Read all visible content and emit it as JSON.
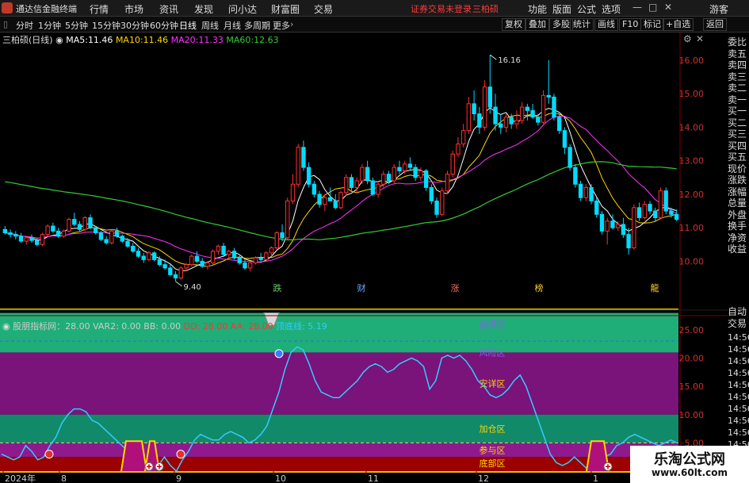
{
  "app": {
    "title": "通达信金融终端"
  },
  "menu": [
    "行情",
    "市场",
    "资讯",
    "发现",
    "问小达",
    "财富圈",
    "交易"
  ],
  "menu_right": {
    "warning": "证券交易未登录",
    "stock": "三柏硕",
    "items": [
      "功能",
      "版面",
      "公式",
      "选项"
    ],
    "guest": "游客"
  },
  "periods": [
    "分时",
    "1分钟",
    "5分钟",
    "15分钟",
    "30分钟",
    "60分钟",
    "日线",
    "周线",
    "月线",
    "多周期",
    "更多"
  ],
  "active_period": "日线",
  "toolbar": [
    "复权",
    "叠加",
    "多股",
    "统计",
    "画线",
    "F10",
    "标记",
    "+自选",
    "返回"
  ],
  "stock_label": "三柏硕(日线)",
  "ma": [
    {
      "label": "MA5:",
      "value": "11.46",
      "color": "#ffffff"
    },
    {
      "label": "MA10:",
      "value": "11.46",
      "color": "#ffd700"
    },
    {
      "label": "MA20:",
      "value": "11.33",
      "color": "#ff33ff"
    },
    {
      "label": "MA60:",
      "value": "12.63",
      "color": "#33cc33"
    }
  ],
  "price_axis": [
    "16.00",
    "15.00",
    "14.00",
    "13.00",
    "12.00",
    "11.00",
    "10.00"
  ],
  "annotations": {
    "high": "16.16",
    "low": "9.40"
  },
  "events": [
    {
      "label": "跌",
      "color": "#66cc66"
    },
    {
      "label": "财",
      "color": "#66aaff"
    },
    {
      "label": "涨",
      "color": "#ff6666"
    },
    {
      "label": "榜",
      "color": "#ffcc33"
    },
    {
      "label": "龍",
      "color": "#ffcc33"
    }
  ],
  "indicator_header": [
    {
      "text": "股朋指标网：28.00",
      "color": "#cccccc"
    },
    {
      "text": "VAR2: 0.00",
      "color": "#cccccc"
    },
    {
      "text": "BB: 0.00",
      "color": "#cccccc"
    },
    {
      "text": "DD: 28.00",
      "color": "#ff3333"
    },
    {
      "text": "AA: 28.00",
      "color": "#ff3333"
    },
    {
      "text": "顶底线: 5.19",
      "color": "#33ccff"
    }
  ],
  "indicator_axis": [
    "25.00",
    "20.00",
    "15.00",
    "10.00",
    "5.00"
  ],
  "zones": [
    {
      "label": "逃顶区",
      "color": "#8a5cf0"
    },
    {
      "label": "风险区",
      "color": "#8a5cf0"
    },
    {
      "label": "安详区",
      "color": "#ffd700"
    },
    {
      "label": "加仓区",
      "color": "#ffd700"
    },
    {
      "label": "参与区",
      "color": "#ffd700"
    },
    {
      "label": "底部区",
      "color": "#ffd700"
    }
  ],
  "date_axis": [
    "2024年",
    "8",
    "9",
    "10",
    "11",
    "12",
    "1"
  ],
  "side_labels": [
    "委比",
    "卖五",
    "卖四",
    "卖三",
    "卖二",
    "卖一",
    "买一",
    "买二",
    "买三",
    "买四",
    "买五",
    "现价",
    "涨跌",
    "涨幅",
    "总量",
    "外盘",
    "换手",
    "净资",
    "收益"
  ],
  "side_bottom": [
    "自动",
    "交易"
  ],
  "times": [
    "14:56",
    "14:56",
    "14:56",
    "14:56",
    "14:56",
    "14:56",
    "14:56",
    "14:56",
    "14:56",
    "14:56"
  ],
  "watermark": {
    "name": "乐淘公式网",
    "url": "www.60lt.com"
  },
  "colors": {
    "up": "#ff3030",
    "down": "#00dcff",
    "ma5": "#ffffff",
    "ma10": "#ffd700",
    "ma20": "#ff33ff",
    "ma60": "#33cc33",
    "kdj": "#33ccff"
  },
  "chart_data": {
    "type": "candlestick",
    "x_range": [
      "2024-07",
      "2025-01"
    ],
    "ylim": [
      9.3,
      16.4
    ],
    "candles": [
      [
        10.95,
        11.05,
        10.8,
        10.85
      ],
      [
        10.85,
        10.95,
        10.7,
        10.8
      ],
      [
        10.8,
        10.9,
        10.65,
        10.75
      ],
      [
        10.75,
        10.85,
        10.55,
        10.6
      ],
      [
        10.6,
        10.75,
        10.5,
        10.7
      ],
      [
        10.7,
        10.8,
        10.55,
        10.62
      ],
      [
        10.62,
        10.68,
        10.45,
        10.5
      ],
      [
        10.5,
        10.85,
        10.45,
        10.8
      ],
      [
        10.8,
        11.1,
        10.75,
        11.05
      ],
      [
        11.05,
        11.15,
        10.85,
        10.9
      ],
      [
        10.9,
        11.0,
        10.7,
        10.75
      ],
      [
        10.75,
        10.95,
        10.7,
        10.9
      ],
      [
        10.9,
        11.3,
        10.85,
        11.25
      ],
      [
        11.25,
        11.45,
        11.05,
        11.1
      ],
      [
        11.1,
        11.2,
        10.9,
        10.95
      ],
      [
        10.95,
        11.35,
        10.9,
        11.3
      ],
      [
        11.3,
        11.4,
        10.95,
        11.0
      ],
      [
        11.0,
        11.05,
        10.8,
        10.85
      ],
      [
        10.85,
        10.9,
        10.6,
        10.65
      ],
      [
        10.65,
        10.75,
        10.5,
        10.55
      ],
      [
        10.55,
        10.95,
        10.5,
        10.9
      ],
      [
        10.9,
        11.0,
        10.7,
        10.75
      ],
      [
        10.75,
        10.8,
        10.55,
        10.6
      ],
      [
        10.6,
        10.7,
        10.4,
        10.45
      ],
      [
        10.45,
        10.55,
        10.25,
        10.3
      ],
      [
        10.3,
        10.4,
        10.1,
        10.15
      ],
      [
        10.15,
        10.25,
        9.95,
        10.05
      ],
      [
        10.05,
        10.3,
        10.0,
        10.25
      ],
      [
        10.25,
        10.3,
        10.0,
        10.05
      ],
      [
        10.05,
        10.15,
        9.85,
        9.9
      ],
      [
        9.9,
        10.05,
        9.75,
        9.8
      ],
      [
        9.8,
        9.9,
        9.55,
        9.6
      ],
      [
        9.6,
        9.7,
        9.4,
        9.5
      ],
      [
        9.5,
        9.85,
        9.45,
        9.8
      ],
      [
        9.8,
        9.95,
        9.7,
        9.9
      ],
      [
        9.9,
        10.2,
        9.85,
        10.15
      ],
      [
        10.15,
        10.3,
        9.95,
        10.0
      ],
      [
        10.0,
        10.1,
        9.8,
        9.85
      ],
      [
        9.85,
        10.0,
        9.75,
        9.95
      ],
      [
        9.95,
        10.35,
        9.9,
        10.3
      ],
      [
        10.3,
        10.5,
        10.2,
        10.45
      ],
      [
        10.45,
        10.55,
        10.15,
        10.2
      ],
      [
        10.2,
        10.35,
        10.05,
        10.3
      ],
      [
        10.3,
        10.4,
        10.05,
        10.1
      ],
      [
        10.1,
        10.2,
        9.9,
        9.95
      ],
      [
        9.95,
        10.05,
        9.75,
        9.8
      ],
      [
        9.8,
        10.0,
        9.7,
        9.95
      ],
      [
        9.95,
        10.15,
        9.9,
        10.1
      ],
      [
        10.1,
        10.25,
        10.0,
        10.05
      ],
      [
        10.05,
        10.3,
        10.0,
        10.25
      ],
      [
        10.25,
        10.45,
        10.15,
        10.4
      ],
      [
        10.4,
        10.9,
        10.35,
        10.85
      ],
      [
        10.85,
        11.1,
        10.6,
        10.7
      ],
      [
        10.7,
        11.9,
        10.65,
        11.8
      ],
      [
        11.8,
        12.6,
        11.7,
        12.3
      ],
      [
        12.3,
        13.5,
        12.2,
        13.4
      ],
      [
        13.4,
        13.6,
        12.7,
        12.8
      ],
      [
        12.8,
        12.95,
        12.2,
        12.3
      ],
      [
        12.3,
        12.4,
        11.9,
        12.0
      ],
      [
        12.0,
        12.1,
        11.6,
        11.7
      ],
      [
        11.7,
        12.0,
        11.5,
        11.9
      ],
      [
        11.9,
        12.2,
        11.8,
        11.8
      ],
      [
        11.8,
        12.0,
        11.55,
        11.6
      ],
      [
        11.6,
        12.1,
        11.55,
        12.05
      ],
      [
        12.05,
        12.6,
        11.95,
        12.5
      ],
      [
        12.5,
        12.6,
        12.1,
        12.2
      ],
      [
        12.2,
        12.5,
        12.05,
        12.4
      ],
      [
        12.4,
        12.9,
        12.3,
        12.8
      ],
      [
        12.8,
        13.0,
        12.3,
        12.4
      ],
      [
        12.4,
        12.5,
        11.95,
        12.0
      ],
      [
        12.0,
        12.4,
        11.9,
        12.3
      ],
      [
        12.3,
        12.7,
        12.2,
        12.6
      ],
      [
        12.6,
        12.7,
        12.3,
        12.4
      ],
      [
        12.4,
        12.9,
        12.3,
        12.8
      ],
      [
        12.8,
        13.0,
        12.6,
        12.7
      ],
      [
        12.7,
        13.0,
        12.6,
        12.9
      ],
      [
        12.9,
        13.1,
        12.7,
        12.8
      ],
      [
        12.8,
        12.9,
        12.4,
        12.5
      ],
      [
        12.5,
        12.8,
        12.4,
        12.7
      ],
      [
        12.7,
        12.75,
        12.1,
        12.2
      ],
      [
        12.2,
        12.3,
        11.7,
        11.8
      ],
      [
        11.8,
        11.9,
        11.3,
        11.4
      ],
      [
        11.4,
        12.2,
        11.35,
        12.1
      ],
      [
        12.1,
        12.7,
        12.0,
        12.6
      ],
      [
        12.6,
        13.3,
        12.5,
        13.2
      ],
      [
        13.2,
        13.7,
        13.1,
        13.5
      ],
      [
        13.5,
        14.1,
        13.4,
        13.9
      ],
      [
        13.9,
        14.9,
        13.8,
        14.7
      ],
      [
        14.7,
        15.1,
        14.2,
        14.4
      ],
      [
        14.4,
        14.6,
        13.8,
        14.0
      ],
      [
        14.0,
        15.4,
        13.9,
        15.2
      ],
      [
        15.2,
        16.16,
        14.4,
        14.6
      ],
      [
        14.6,
        15.0,
        13.9,
        14.1
      ],
      [
        14.1,
        14.4,
        13.8,
        14.0
      ],
      [
        14.0,
        14.4,
        13.85,
        14.3
      ],
      [
        14.3,
        14.4,
        13.95,
        14.1
      ],
      [
        14.1,
        14.5,
        13.95,
        14.2
      ],
      [
        14.2,
        14.75,
        14.1,
        14.6
      ],
      [
        14.6,
        14.7,
        14.2,
        14.5
      ],
      [
        14.5,
        14.7,
        14.25,
        14.3
      ],
      [
        14.3,
        14.4,
        14.05,
        14.15
      ],
      [
        14.15,
        15.1,
        14.1,
        14.95
      ],
      [
        14.95,
        16.0,
        14.7,
        14.9
      ],
      [
        14.9,
        15.0,
        14.2,
        14.3
      ],
      [
        14.3,
        14.4,
        13.8,
        13.9
      ],
      [
        13.9,
        14.0,
        13.2,
        13.4
      ],
      [
        13.4,
        13.5,
        12.7,
        12.8
      ],
      [
        12.8,
        12.9,
        12.2,
        12.3
      ],
      [
        12.3,
        12.4,
        11.8,
        11.9
      ],
      [
        11.9,
        12.3,
        11.8,
        12.2
      ],
      [
        12.2,
        12.3,
        11.7,
        11.8
      ],
      [
        11.8,
        11.9,
        11.3,
        11.4
      ],
      [
        11.4,
        11.5,
        10.8,
        10.9
      ],
      [
        10.9,
        11.3,
        10.5,
        11.2
      ],
      [
        11.2,
        11.4,
        10.95,
        11.0
      ],
      [
        11.0,
        11.2,
        10.9,
        11.1
      ],
      [
        11.1,
        11.3,
        10.7,
        10.8
      ],
      [
        10.8,
        11.0,
        10.2,
        10.4
      ],
      [
        10.4,
        11.7,
        10.35,
        11.6
      ],
      [
        11.6,
        11.75,
        11.2,
        11.3
      ],
      [
        11.3,
        11.8,
        11.25,
        11.7
      ],
      [
        11.7,
        11.8,
        11.4,
        11.5
      ],
      [
        11.5,
        11.6,
        11.2,
        11.3
      ],
      [
        11.3,
        12.2,
        11.25,
        12.1
      ],
      [
        12.1,
        12.2,
        11.4,
        11.5
      ],
      [
        11.5,
        11.6,
        11.3,
        11.4
      ],
      [
        11.4,
        11.55,
        11.2,
        11.25
      ]
    ],
    "ma_series": [
      "MA5",
      "MA10",
      "MA20",
      "MA60"
    ],
    "indicator": {
      "name": "股朋指标网",
      "ylim": [
        0,
        28.5
      ],
      "line": [
        3.0,
        2.5,
        2.0,
        2.5,
        4.5,
        3.5,
        2.0,
        2.5,
        4.5,
        6.0,
        8.5,
        10.0,
        11.0,
        11.0,
        10.5,
        9.0,
        8.5,
        7.5,
        6.5,
        5.5,
        4.5,
        3.5,
        2.0,
        1.0,
        0.5,
        0.0,
        1.0,
        2.5,
        1.0,
        0.0,
        2.0,
        3.5,
        5.5,
        6.5,
        6.0,
        5.5,
        5.5,
        6.5,
        7.0,
        6.5,
        6.0,
        5.0,
        5.5,
        6.5,
        8.0,
        11.0,
        14.0,
        18.0,
        21.0,
        22.0,
        21.5,
        19.0,
        16.0,
        14.0,
        13.5,
        13.0,
        13.0,
        14.0,
        15.0,
        16.0,
        17.5,
        18.5,
        19.0,
        18.5,
        17.5,
        18.0,
        19.0,
        19.5,
        20.0,
        19.5,
        18.5,
        14.5,
        16.0,
        20.0,
        20.5,
        20.0,
        20.5,
        19.5,
        18.0,
        16.0,
        15.0,
        13.5,
        13.0,
        13.5,
        14.5,
        16.0,
        17.0,
        15.0,
        12.0,
        9.0,
        6.0,
        3.0,
        1.5,
        1.0,
        1.5,
        2.5,
        1.5,
        0.5,
        1.0,
        2.0,
        2.5,
        3.0,
        4.5,
        5.0,
        6.0,
        6.5,
        6.0,
        5.5,
        5.0,
        4.5,
        5.0,
        5.5,
        5.0
      ],
      "zones": [
        [
          28,
          21
        ],
        [
          21,
          10
        ],
        [
          10,
          5
        ],
        [
          5,
          2.5
        ],
        [
          2.5,
          0
        ]
      ]
    }
  }
}
